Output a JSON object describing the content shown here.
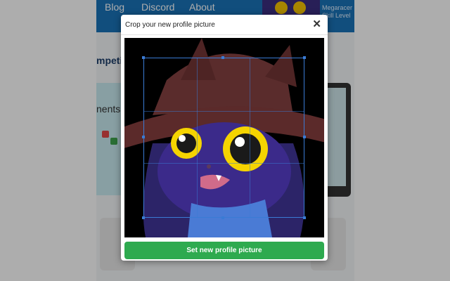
{
  "nav": {
    "links": [
      "Blog",
      "Discord",
      "About"
    ]
  },
  "user": {
    "name": "Megaracer",
    "level": "Skill Level"
  },
  "background": {
    "heading_fragment": "mpeti",
    "card_fragment": "nents"
  },
  "dialog": {
    "title": "Crop your new profile picture",
    "close_icon": "close-icon",
    "close_symbol": "✕",
    "submit_label": "Set new profile picture"
  },
  "colors": {
    "nav_bg": "#1a73b8",
    "submit_bg": "#2eaa4f",
    "crop_border": "#3a7bd5",
    "crop_bg": "#000000"
  }
}
